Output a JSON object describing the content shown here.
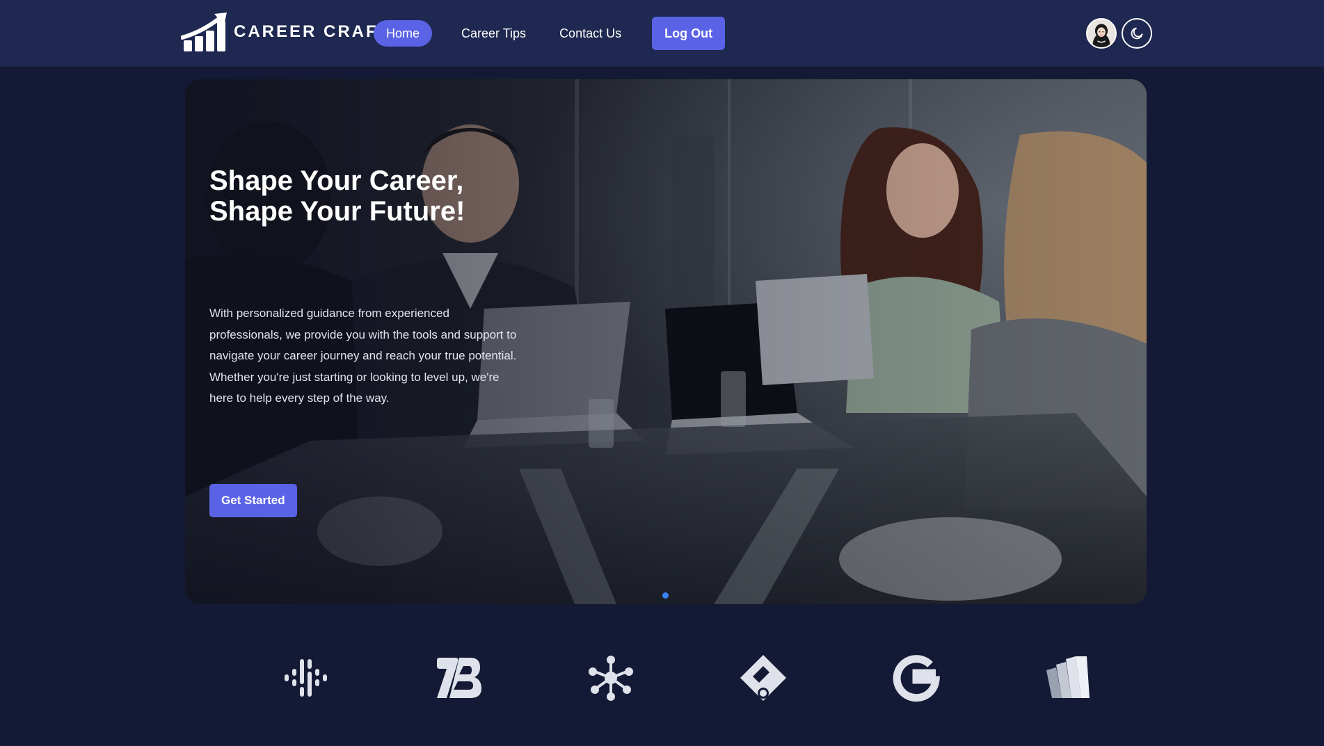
{
  "header": {
    "brand": "CAREER CRAFT",
    "nav": [
      {
        "label": "Home",
        "active": true
      },
      {
        "label": "Career Tips",
        "active": false
      },
      {
        "label": "Contact Us",
        "active": false
      }
    ],
    "logout_label": "Log Out",
    "avatar_icon": "user-avatar",
    "theme_icon": "moon-icon"
  },
  "hero": {
    "title_line1": "Shape Your Career,",
    "title_line2": "Shape Your Future!",
    "description": "With personalized guidance from experienced professionals, we provide you with the tools and support to navigate your career journey and reach your true potential. Whether you're just starting or looking to level up, we're here to help every step of the way.",
    "cta_label": "Get Started",
    "carousel": {
      "slides": 1,
      "active": 1
    }
  },
  "partners": [
    {
      "icon": "podcast-wave-icon"
    },
    {
      "icon": "tb-monogram-icon"
    },
    {
      "icon": "network-nodes-icon"
    },
    {
      "icon": "diamond-tag-icon"
    },
    {
      "icon": "google-g-icon"
    },
    {
      "icon": "w-stripes-icon"
    }
  ],
  "colors": {
    "page_bg": "#141a35",
    "navbar_bg": "#1e2850",
    "accent": "#5a63e6",
    "dot": "#3b82f6"
  }
}
